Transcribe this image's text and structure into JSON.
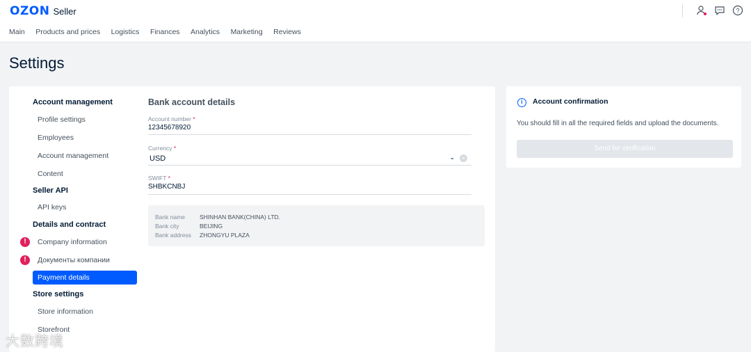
{
  "header": {
    "logo": "OZON",
    "logo_sub": "Seller",
    "nav": [
      "Main",
      "Products and prices",
      "Logistics",
      "Finances",
      "Analytics",
      "Marketing",
      "Reviews"
    ],
    "icons": [
      "user-icon",
      "chat-icon",
      "help-icon"
    ]
  },
  "page": {
    "title": "Settings"
  },
  "sidebar": {
    "groups": [
      {
        "label": "Account management",
        "items": [
          {
            "label": "Profile settings"
          },
          {
            "label": "Employees"
          },
          {
            "label": "Account management"
          },
          {
            "label": "Content"
          }
        ]
      },
      {
        "label": "Seller API",
        "items": [
          {
            "label": "API keys"
          }
        ]
      },
      {
        "label": "Details and contract",
        "items": [
          {
            "label": "Company information",
            "alert": true
          },
          {
            "label": "Документы компании",
            "alert": true
          },
          {
            "label": "Payment details",
            "active": true
          }
        ]
      },
      {
        "label": "Store settings",
        "items": [
          {
            "label": "Store information"
          },
          {
            "label": "Storefront"
          }
        ]
      }
    ]
  },
  "bank": {
    "title": "Bank account details",
    "account_number": {
      "label": "Account number",
      "value": "12345678920"
    },
    "currency": {
      "label": "Currency",
      "value": "USD"
    },
    "swift": {
      "label": "SWIFT",
      "value": "SHBKCNBJ"
    },
    "details": {
      "bank_name": {
        "label": "Bank name",
        "value": "SHINHAN BANK(CHINA) LTD."
      },
      "bank_city": {
        "label": "Bank city",
        "value": "BEIJING"
      },
      "bank_address": {
        "label": "Bank address",
        "value": "ZHONGYU PLAZA"
      }
    }
  },
  "confirmation": {
    "title": "Account confirmation",
    "text": "You should fill in all the required fields and upload the documents.",
    "button": "Send for verification"
  },
  "watermark": "大数跨境",
  "colors": {
    "accent": "#005bff",
    "alert": "#e0205c",
    "text": "#001a34"
  }
}
